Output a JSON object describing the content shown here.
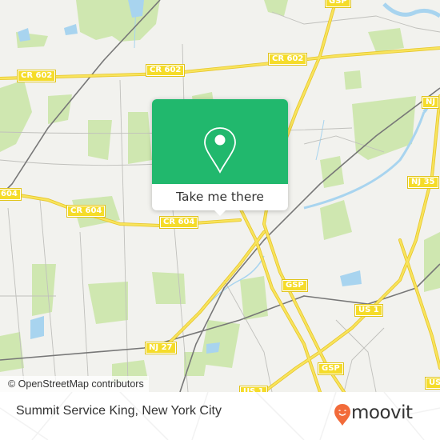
{
  "map": {
    "attribution": "© OpenStreetMap contributors",
    "road_labels": [
      {
        "id": "cr602-west",
        "text": "CR 602"
      },
      {
        "id": "cr602-mid",
        "text": "CR 602"
      },
      {
        "id": "cr602-east",
        "text": "CR 602"
      },
      {
        "id": "cr604-west",
        "text": "604"
      },
      {
        "id": "cr604-mid",
        "text": "CR 604"
      },
      {
        "id": "cr604-east",
        "text": "CR 604"
      },
      {
        "id": "gsp-top",
        "text": "GSP"
      },
      {
        "id": "gsp-mid",
        "text": "GSP"
      },
      {
        "id": "gsp-south",
        "text": "GSP"
      },
      {
        "id": "nj-ne",
        "text": "NJ"
      },
      {
        "id": "nj35",
        "text": "NJ 35"
      },
      {
        "id": "nj27",
        "text": "NJ 27"
      },
      {
        "id": "us1-mid",
        "text": "US 1"
      },
      {
        "id": "us1-south",
        "text": "US 1"
      },
      {
        "id": "us-east",
        "text": "US"
      }
    ],
    "colors": {
      "land": "#f2f2ee",
      "park": "#cfe7b0",
      "water": "#a8d4ef",
      "road_major": "#f5dc2a",
      "rail": "#707070"
    }
  },
  "popup": {
    "button_label": "Take me there",
    "icon": "map-pin-icon",
    "accent": "#21b86d"
  },
  "footer": {
    "place_name": "Summit Service King, New York City",
    "brand": "moovit",
    "brand_icon": "moovit-pin-icon",
    "brand_color": "#f26b3a"
  }
}
